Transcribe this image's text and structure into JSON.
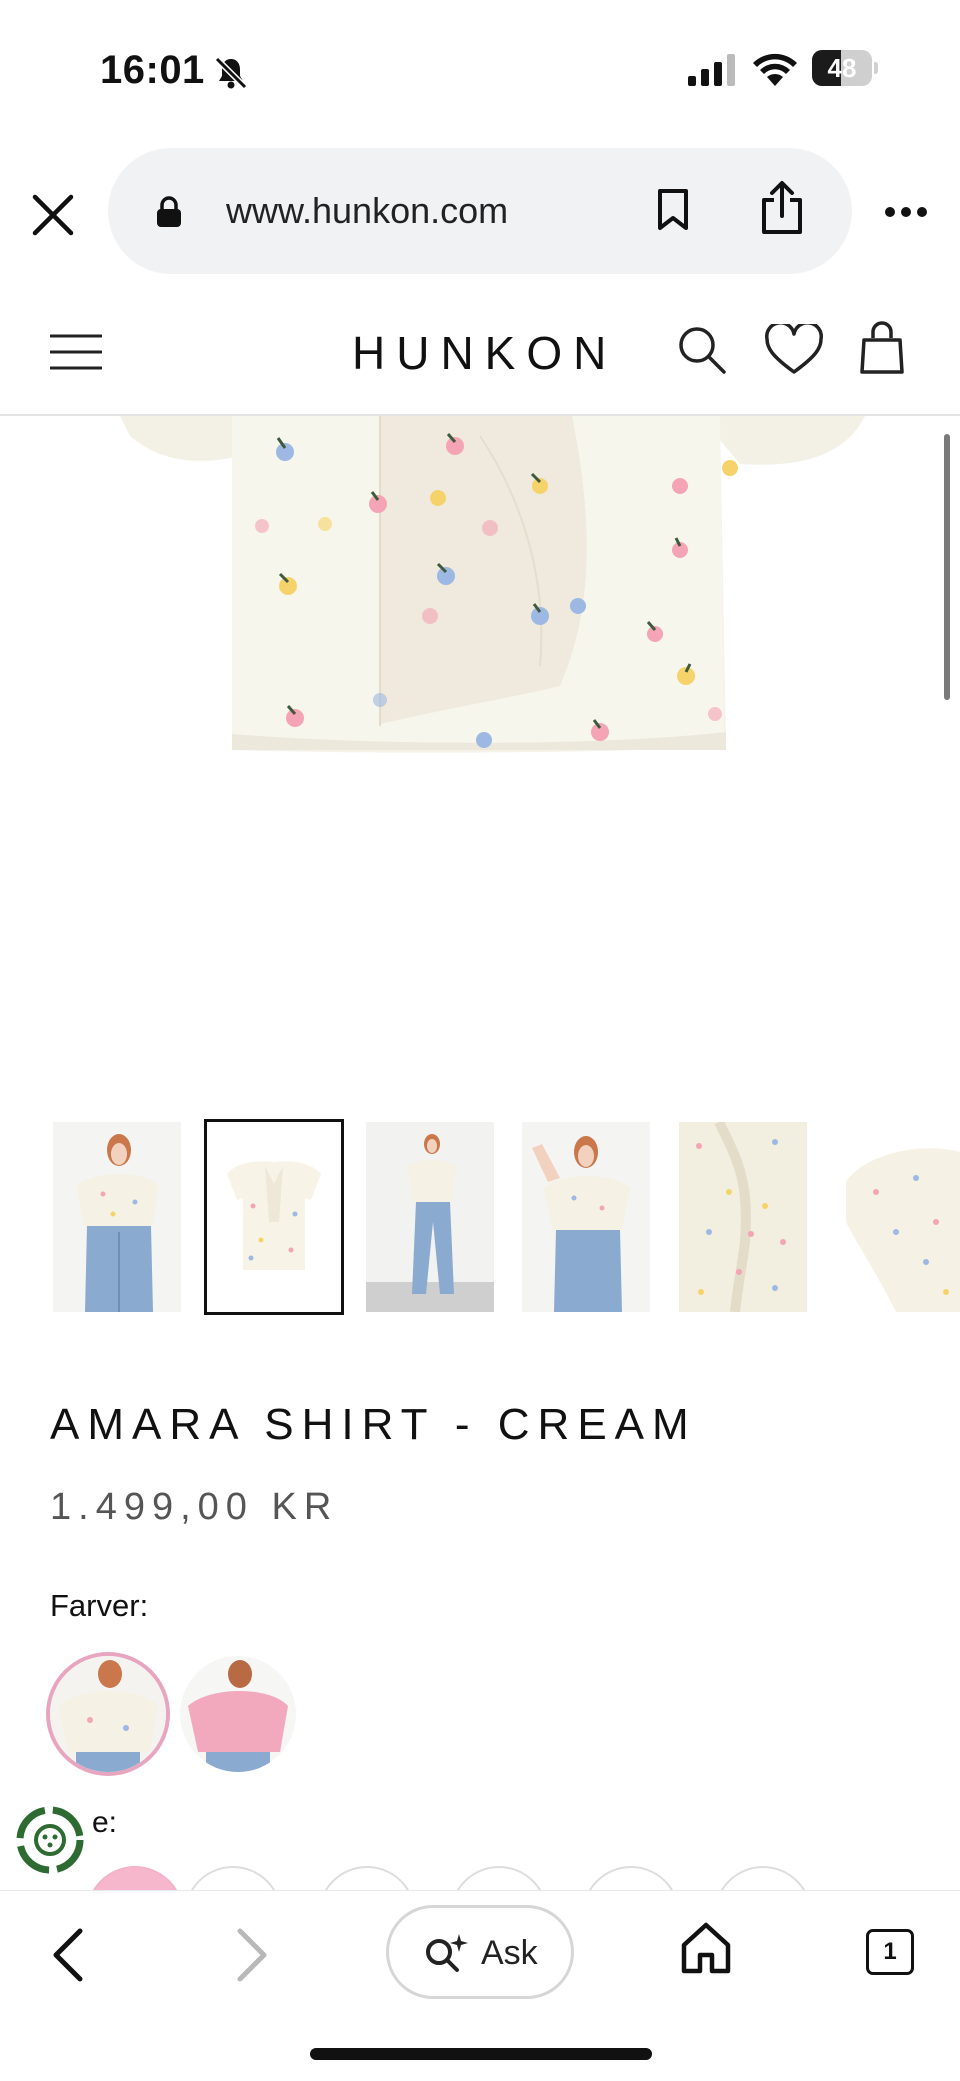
{
  "status_bar": {
    "time": "16:01",
    "battery_level": "48",
    "battery_fraction": 0.48
  },
  "browser": {
    "url": "www.hunkon.com",
    "icons": [
      "close-icon",
      "lock-icon",
      "bookmark-icon",
      "share-icon",
      "more-icon"
    ]
  },
  "site_header": {
    "logo": "HUNKON",
    "icons": [
      "menu-icon",
      "search-icon",
      "heart-icon",
      "bag-icon"
    ]
  },
  "product": {
    "title": "AMARA SHIRT - CREAM",
    "price": "1.499,00 KR",
    "colors_label": "Farver:",
    "size_label_visible": "e:",
    "thumbnail_count": 6,
    "selected_thumbnail": 2,
    "swatches": [
      "cream",
      "pink"
    ]
  },
  "toolbar": {
    "ask_label": "Ask",
    "tab_count": "1"
  },
  "colors": {
    "cream": "#f7f3e7",
    "pink_accent": "#e8a5bf",
    "text": "#111111",
    "price_text": "#555555"
  }
}
